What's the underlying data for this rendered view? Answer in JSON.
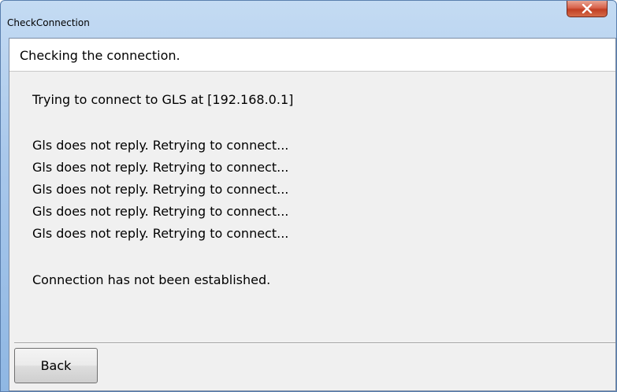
{
  "window": {
    "title": "CheckConnection",
    "close_icon": "close-icon",
    "accent_color": "#c8412a"
  },
  "header": {
    "text": "Checking the connection."
  },
  "log": {
    "lines": [
      "Trying to connect to GLS at [192.168.0.1]",
      "Gls does not reply. Retrying to connect...",
      "Gls does not reply. Retrying to connect...",
      "Gls does not reply. Retrying to connect...",
      "Gls does not reply. Retrying to connect...",
      "Gls does not reply. Retrying to connect...",
      "Connection has not been established."
    ]
  },
  "footer": {
    "back_label": "Back"
  }
}
